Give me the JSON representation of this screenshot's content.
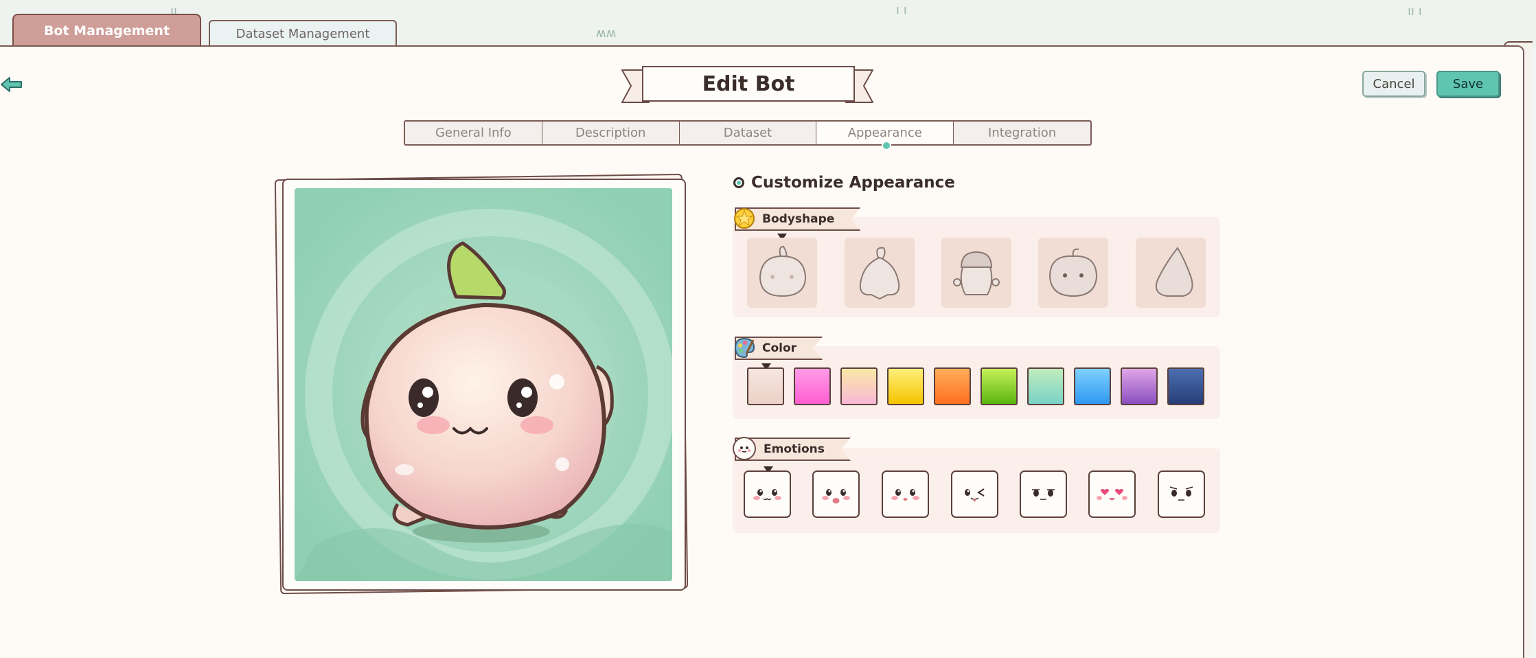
{
  "top_tabs": {
    "bot_management": "Bot Management",
    "dataset_management": "Dataset Management"
  },
  "page": {
    "title": "Edit Bot",
    "cancel": "Cancel",
    "save": "Save"
  },
  "sub_tabs": [
    "General Info",
    "Description",
    "Dataset",
    "Appearance",
    "Integration"
  ],
  "active_sub_tab": "Appearance",
  "customize": {
    "title": "Customize Appearance"
  },
  "bodyshape": {
    "label": "Bodyshape",
    "options": [
      "round-sprout",
      "bag-sprout",
      "acorn",
      "apple",
      "drop"
    ],
    "selected": 0
  },
  "color": {
    "label": "Color",
    "selected": 0,
    "swatches": [
      {
        "name": "cream",
        "top": "#f6e6df",
        "bottom": "#ecd1c7"
      },
      {
        "name": "pink",
        "top": "#ff9be6",
        "bottom": "#ff5fd2"
      },
      {
        "name": "peach-pastel",
        "top": "#fbe9a6",
        "bottom": "#f7b8d6"
      },
      {
        "name": "yellow",
        "top": "#fff07a",
        "bottom": "#f5c400"
      },
      {
        "name": "orange",
        "top": "#ffae5a",
        "bottom": "#ff6f21"
      },
      {
        "name": "lime",
        "top": "#c6f05a",
        "bottom": "#5bb50e"
      },
      {
        "name": "mint",
        "top": "#c0ecbc",
        "bottom": "#7ad2c8"
      },
      {
        "name": "sky",
        "top": "#7fd1ff",
        "bottom": "#2f98f0"
      },
      {
        "name": "violet",
        "top": "#e0a6e8",
        "bottom": "#8a4fbf"
      },
      {
        "name": "navy",
        "top": "#4c6fb0",
        "bottom": "#263e78"
      }
    ]
  },
  "emotions": {
    "label": "Emotions",
    "selected": 0,
    "options": [
      "happy",
      "surprised",
      "content",
      "playful",
      "neutral",
      "love",
      "smug"
    ]
  }
}
